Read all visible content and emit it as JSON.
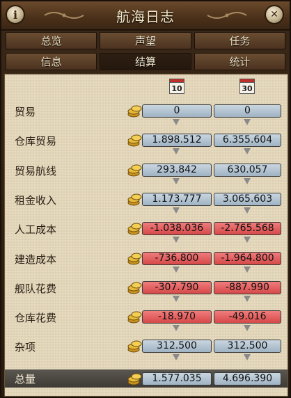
{
  "window": {
    "title": "航海日志",
    "info_label": "i",
    "close_label": "✕"
  },
  "tabs": [
    {
      "label": "总览"
    },
    {
      "label": "声望"
    },
    {
      "label": "任务"
    },
    {
      "label": "信息"
    },
    {
      "label": "结算"
    },
    {
      "label": "统计"
    }
  ],
  "active_tab": "结算",
  "periods": [
    "10",
    "30"
  ],
  "rows": [
    {
      "label": "贸易",
      "v1": "0",
      "v2": "0",
      "type": "pos"
    },
    {
      "label": "仓库贸易",
      "v1": "1.898.512",
      "v2": "6.355.604",
      "type": "pos"
    },
    {
      "label": "贸易航线",
      "v1": "293.842",
      "v2": "630.057",
      "type": "pos"
    },
    {
      "label": "租金收入",
      "v1": "1.173.777",
      "v2": "3.065.603",
      "type": "pos"
    },
    {
      "label": "人工成本",
      "v1": "-1.038.036",
      "v2": "-2.765.568",
      "type": "neg"
    },
    {
      "label": "建造成本",
      "v1": "-736.800",
      "v2": "-1.964.800",
      "type": "neg"
    },
    {
      "label": "舰队花费",
      "v1": "-307.790",
      "v2": "-887.990",
      "type": "neg"
    },
    {
      "label": "仓库花费",
      "v1": "-18.970",
      "v2": "-49.016",
      "type": "neg"
    },
    {
      "label": "杂项",
      "v1": "312.500",
      "v2": "312.500",
      "type": "pos"
    }
  ],
  "total": {
    "label": "总量",
    "v1": "1.577.035",
    "v2": "4.696.390"
  }
}
